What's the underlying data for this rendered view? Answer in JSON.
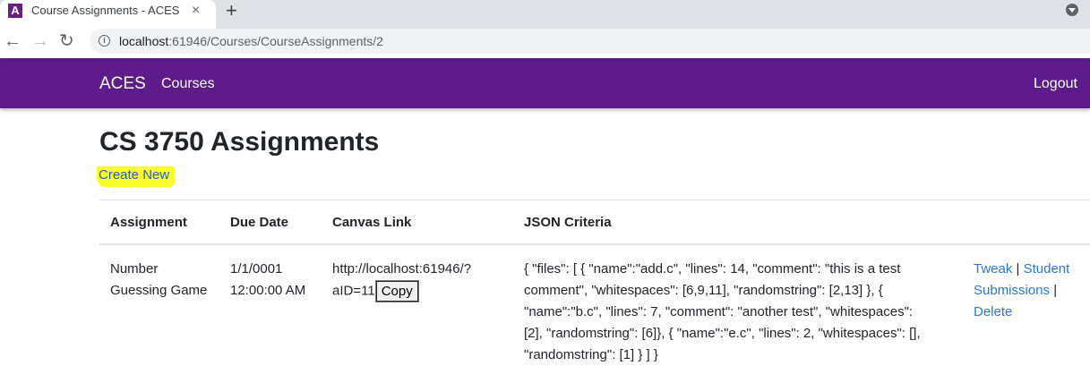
{
  "browser": {
    "tab_title": "Course Assignments - ACES",
    "favicon_letter": "A",
    "tab_close": "×",
    "new_tab": "+",
    "url_host": "localhost",
    "url_path": ":61946/Courses/CourseAssignments/2",
    "back_icon": "←",
    "forward_icon": "→",
    "reload_icon": "↻",
    "info_icon": "i"
  },
  "navbar": {
    "brand": "ACES",
    "courses": "Courses",
    "logout": "Logout",
    "color": "#5e1b89"
  },
  "page": {
    "title": "CS 3750 Assignments",
    "create_new": "Create New"
  },
  "table": {
    "headers": [
      "Assignment",
      "Due Date",
      "Canvas Link",
      "JSON Criteria"
    ],
    "rows": [
      {
        "assignment_line1": "Number",
        "assignment_line2": "Guessing Game",
        "due_line1": "1/1/0001",
        "due_line2": "12:00:00 AM",
        "canvas_line1": "http://localhost:61946/?",
        "canvas_line2": "aID=11",
        "copy_label": "Copy",
        "json_lines": [
          "{ \"files\": [ { \"name\":\"add.c\", \"lines\": 14, \"comment\": \"this is a test",
          "comment\", \"whitespaces\": [6,9,11], \"randomstring\": [2,13] }, {",
          "\"name\":\"b.c\", \"lines\": 7, \"comment\": \"another test\", \"whitespaces\":",
          "[2], \"randomstring\": [6]}, { \"name\":\"e.c\", \"lines\": 2, \"whitespaces\": [],",
          "\"randomstring\": [1] } ] }"
        ],
        "action_tweak": "Tweak",
        "action_sep1": " | ",
        "action_student": "Student",
        "action_submissions": "Submissions",
        "action_sep2": " |",
        "action_delete": "Delete"
      }
    ]
  }
}
